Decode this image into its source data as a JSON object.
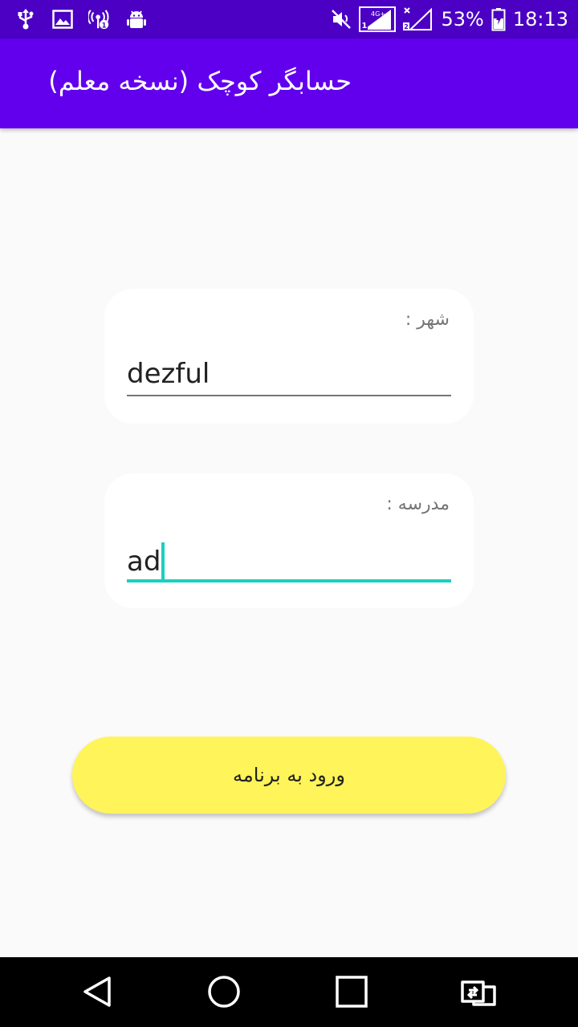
{
  "status_bar": {
    "battery_percent": "53%",
    "time": "18:13",
    "network_label": "4G+",
    "icons": [
      "usb-icon",
      "image-icon",
      "hotspot-icon",
      "android-debug-icon",
      "mute-icon",
      "signal-4g-icon",
      "signal-sim2-icon",
      "battery-icon"
    ]
  },
  "app_bar": {
    "title": "حسابگر کوچک (نسخه معلم)"
  },
  "form": {
    "city": {
      "label": "شهر :",
      "value": "dezful"
    },
    "school": {
      "label": "مدرسه :",
      "value": "ad"
    }
  },
  "enter_button": {
    "label": "ورود به برنامه"
  },
  "nav_bar": {
    "icons": [
      "back-icon",
      "home-icon",
      "recents-icon",
      "rotate-icon"
    ]
  },
  "colors": {
    "status_bar": "#4b00c4",
    "app_bar": "#6200ee",
    "accent": "#1ccfc0",
    "button": "#fff459",
    "background": "#fafafa"
  }
}
